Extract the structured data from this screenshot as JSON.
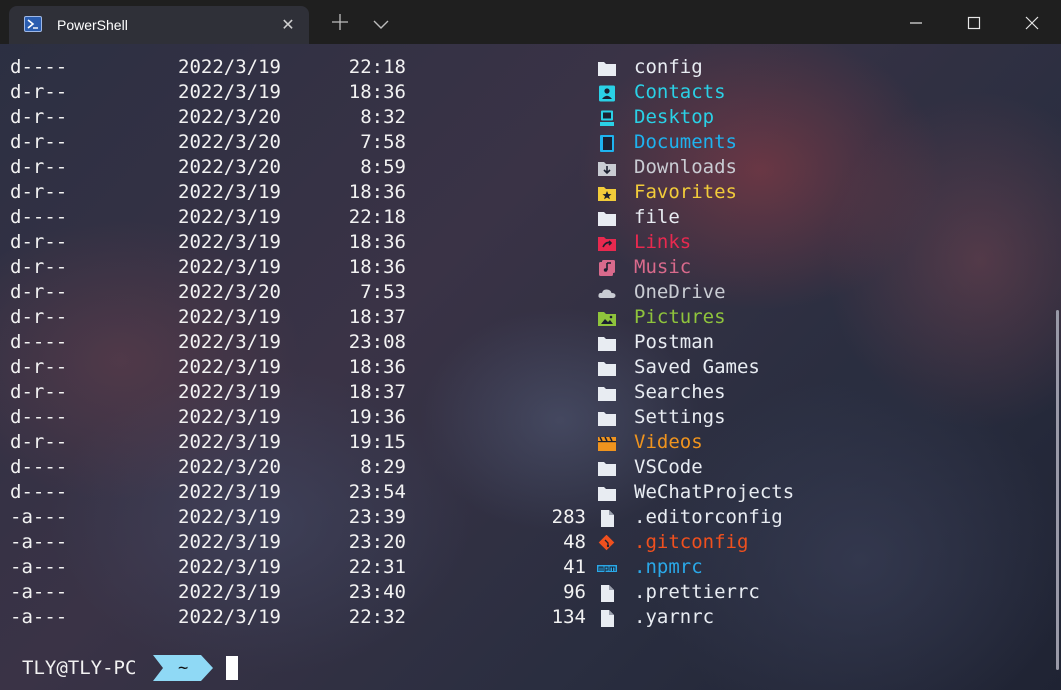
{
  "window": {
    "tab_title": "PowerShell",
    "tab_icon": "powershell-icon",
    "close_tab_glyph": "✕"
  },
  "colors": {
    "folder": "#e8ecf2",
    "contacts": "#2ad1e6",
    "desktop": "#2ad1e6",
    "documents": "#1eb3ef",
    "downloads": "#c9ccd3",
    "favorites": "#f2cc3a",
    "links": "#e8294f",
    "music": "#d96a8c",
    "onedrive": "#c9ccd3",
    "pictures": "#8fc43c",
    "videos": "#f0941e",
    "gitconfig": "#f0501e",
    "npmrc": "#2aa8e8",
    "prompt_segment": "#8fd9f5"
  },
  "listing": [
    {
      "mode": "d----",
      "date": "2022/3/19",
      "time": "22:18",
      "size": "",
      "name": "config",
      "icon": "folder-icon",
      "color": "#e8ecf2"
    },
    {
      "mode": "d-r--",
      "date": "2022/3/19",
      "time": "18:36",
      "size": "",
      "name": "Contacts",
      "icon": "contacts-folder-icon",
      "color": "#2ad1e6"
    },
    {
      "mode": "d-r--",
      "date": "2022/3/20",
      "time": "8:32",
      "size": "",
      "name": "Desktop",
      "icon": "desktop-folder-icon",
      "color": "#2ad1e6"
    },
    {
      "mode": "d-r--",
      "date": "2022/3/20",
      "time": "7:58",
      "size": "",
      "name": "Documents",
      "icon": "documents-folder-icon",
      "color": "#1eb3ef"
    },
    {
      "mode": "d-r--",
      "date": "2022/3/20",
      "time": "8:59",
      "size": "",
      "name": "Downloads",
      "icon": "downloads-folder-icon",
      "color": "#c9ccd3"
    },
    {
      "mode": "d-r--",
      "date": "2022/3/19",
      "time": "18:36",
      "size": "",
      "name": "Favorites",
      "icon": "favorites-folder-icon",
      "color": "#f2cc3a"
    },
    {
      "mode": "d----",
      "date": "2022/3/19",
      "time": "22:18",
      "size": "",
      "name": "file",
      "icon": "folder-icon",
      "color": "#e8ecf2"
    },
    {
      "mode": "d-r--",
      "date": "2022/3/19",
      "time": "18:36",
      "size": "",
      "name": "Links",
      "icon": "links-folder-icon",
      "color": "#e8294f"
    },
    {
      "mode": "d-r--",
      "date": "2022/3/19",
      "time": "18:36",
      "size": "",
      "name": "Music",
      "icon": "music-folder-icon",
      "color": "#d96a8c"
    },
    {
      "mode": "d-r--",
      "date": "2022/3/20",
      "time": "7:53",
      "size": "",
      "name": "OneDrive",
      "icon": "onedrive-cloud-icon",
      "color": "#c9ccd3"
    },
    {
      "mode": "d-r--",
      "date": "2022/3/19",
      "time": "18:37",
      "size": "",
      "name": "Pictures",
      "icon": "pictures-folder-icon",
      "color": "#8fc43c"
    },
    {
      "mode": "d----",
      "date": "2022/3/19",
      "time": "23:08",
      "size": "",
      "name": "Postman",
      "icon": "folder-icon",
      "color": "#e8ecf2"
    },
    {
      "mode": "d-r--",
      "date": "2022/3/19",
      "time": "18:36",
      "size": "",
      "name": "Saved Games",
      "icon": "folder-icon",
      "color": "#e8ecf2"
    },
    {
      "mode": "d-r--",
      "date": "2022/3/19",
      "time": "18:37",
      "size": "",
      "name": "Searches",
      "icon": "folder-icon",
      "color": "#e8ecf2"
    },
    {
      "mode": "d----",
      "date": "2022/3/19",
      "time": "19:36",
      "size": "",
      "name": "Settings",
      "icon": "folder-icon",
      "color": "#e8ecf2"
    },
    {
      "mode": "d-r--",
      "date": "2022/3/19",
      "time": "19:15",
      "size": "",
      "name": "Videos",
      "icon": "videos-folder-icon",
      "color": "#f0941e"
    },
    {
      "mode": "d----",
      "date": "2022/3/20",
      "time": "8:29",
      "size": "",
      "name": "VSCode",
      "icon": "folder-icon",
      "color": "#e8ecf2"
    },
    {
      "mode": "d----",
      "date": "2022/3/19",
      "time": "23:54",
      "size": "",
      "name": "WeChatProjects",
      "icon": "folder-icon",
      "color": "#e8ecf2"
    },
    {
      "mode": "-a---",
      "date": "2022/3/19",
      "time": "23:39",
      "size": "283",
      "name": ".editorconfig",
      "icon": "file-icon",
      "color": "#e8ecf2"
    },
    {
      "mode": "-a---",
      "date": "2022/3/19",
      "time": "23:20",
      "size": "48",
      "name": ".gitconfig",
      "icon": "git-icon",
      "color": "#f0501e"
    },
    {
      "mode": "-a---",
      "date": "2022/3/19",
      "time": "22:31",
      "size": "41",
      "name": ".npmrc",
      "icon": "npm-icon",
      "color": "#2aa8e8"
    },
    {
      "mode": "-a---",
      "date": "2022/3/19",
      "time": "23:40",
      "size": "96",
      "name": ".prettierrc",
      "icon": "file-icon",
      "color": "#e8ecf2"
    },
    {
      "mode": "-a---",
      "date": "2022/3/19",
      "time": "22:32",
      "size": "134",
      "name": ".yarnrc",
      "icon": "file-icon",
      "color": "#e8ecf2"
    }
  ],
  "prompt": {
    "user_host": "TLY@TLY-PC",
    "path": "~"
  }
}
